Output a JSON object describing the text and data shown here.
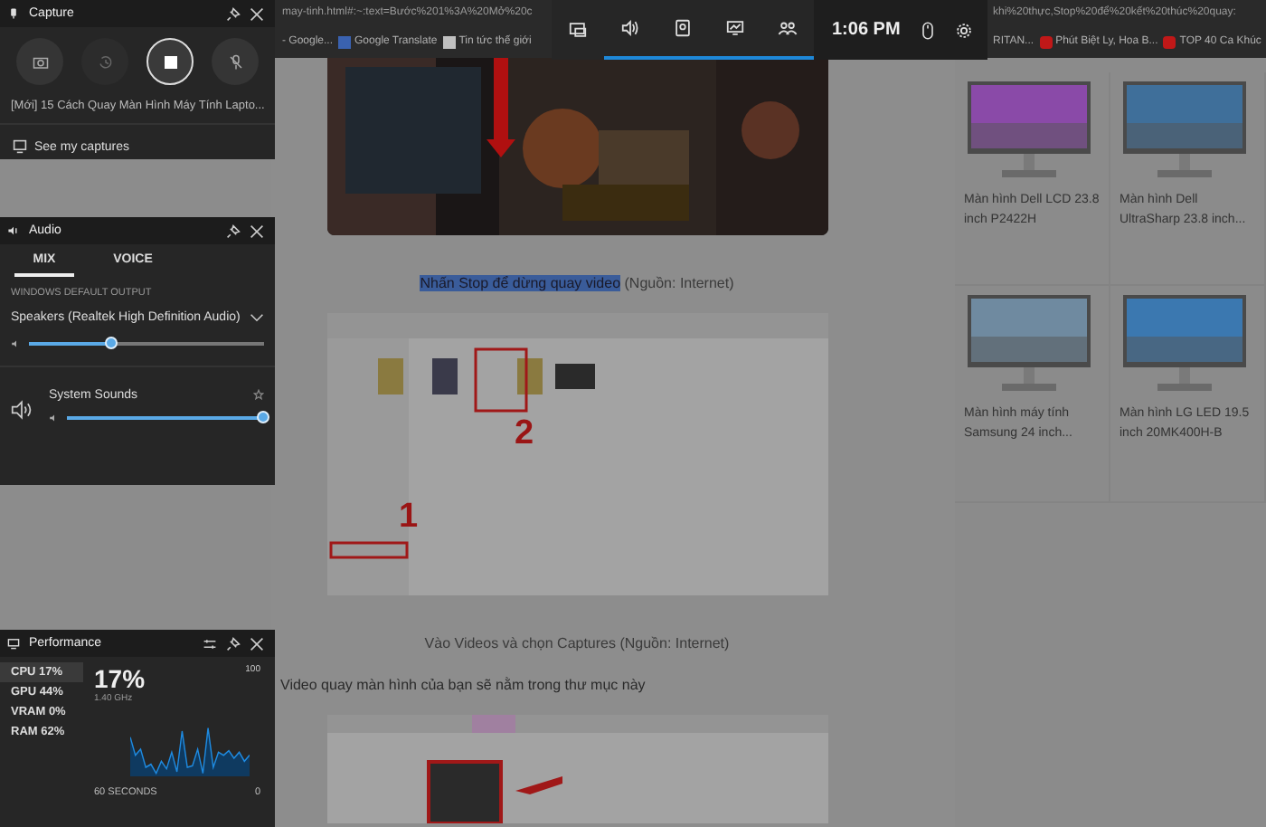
{
  "browser": {
    "url_left": "may-tinh.html#:~:text=Bước%201%3A%20Mở%20c",
    "url_right": "khi%20thực,Stop%20để%20kết%20thúc%20quay:",
    "bookmarks_left": [
      {
        "label": "- Google..."
      },
      {
        "label": "Google Translate",
        "kind": "translate"
      },
      {
        "label": "Tin tức thế giới",
        "kind": "news"
      }
    ],
    "bookmarks_right": [
      {
        "label": "RITAN..."
      },
      {
        "label": "Phút Biệt Ly, Hoa B...",
        "kind": "video"
      },
      {
        "label": "TOP 40 Ca Khúc",
        "kind": "video"
      }
    ]
  },
  "game_bar": {
    "widgets": [
      {
        "kind": "overlay",
        "active": false
      },
      {
        "kind": "audio",
        "active": true
      },
      {
        "kind": "capture",
        "active": true
      },
      {
        "kind": "performance",
        "active": true
      },
      {
        "kind": "social",
        "active": true
      }
    ],
    "time": "1:06 PM"
  },
  "article": {
    "caption_1_highlighted": "Nhấn Stop để dừng quay video",
    "caption_1_rest": " (Nguồn: Internet)",
    "explorer_marks": [
      "2",
      "1"
    ],
    "caption_2": "Vào Videos và chọn Captures (Nguồn: Internet)",
    "paragraph": "Video quay màn hình của bạn sẽ nằm trong thư mục này"
  },
  "products": [
    {
      "name": "Màn hình Dell LCD 23.8 inch P2422H"
    },
    {
      "name": "Màn hình Dell UltraSharp 23.8 inch..."
    },
    {
      "name": "Màn hình máy tính Samsung 24 inch..."
    },
    {
      "name": "Màn hình LG LED 19.5 inch 20MK400H-B"
    }
  ],
  "capture": {
    "title": "Capture",
    "recording": true,
    "mic_muted": true,
    "file": "[Mới] 15 Cách Quay Màn Hình Máy Tính Lapto...",
    "link": "See my captures"
  },
  "audio": {
    "title": "Audio",
    "tabs": [
      {
        "label": "MIX",
        "selected": true
      },
      {
        "label": "VOICE",
        "selected": false
      }
    ],
    "section": "WINDOWS DEFAULT OUTPUT",
    "device": "Speakers (Realtek High Definition Audio)",
    "level": 0.35,
    "apps": [
      {
        "name": "System Sounds",
        "level": 1.0
      }
    ]
  },
  "performance": {
    "title": "Performance",
    "metrics": [
      {
        "label": "CPU",
        "value": "17%",
        "selected": true
      },
      {
        "label": "GPU",
        "value": "44%",
        "selected": false
      },
      {
        "label": "VRAM",
        "value": "0%",
        "selected": false
      },
      {
        "label": "RAM",
        "value": "62%",
        "selected": false
      }
    ],
    "big": "17%",
    "sub": "1.40 GHz",
    "max": "100",
    "min": "0",
    "span": "60 SECONDS"
  }
}
